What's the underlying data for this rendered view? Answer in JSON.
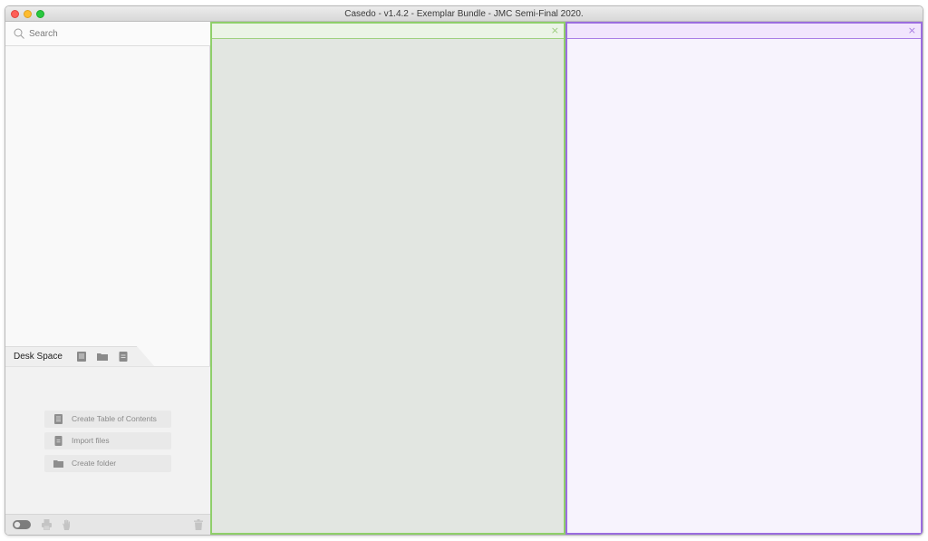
{
  "window": {
    "title": "Casedo - v1.4.2 - Exemplar Bundle - JMC Semi-Final 2020."
  },
  "sidebar": {
    "search": {
      "placeholder": "Search",
      "value": ""
    },
    "desk_space": {
      "tab_label": "Desk Space",
      "tab_icons": [
        "table-of-contents-icon",
        "folder-icon",
        "document-icon"
      ],
      "actions": [
        {
          "label": "Create Table of Contents",
          "icon": "table-of-contents-icon"
        },
        {
          "label": "Import files",
          "icon": "document-icon"
        },
        {
          "label": "Create folder",
          "icon": "folder-icon"
        }
      ]
    },
    "bottom_bar": {
      "icons": [
        "toggle-icon",
        "print-icon",
        "hand-icon",
        "trash-icon"
      ]
    }
  },
  "panes": {
    "left": {
      "accent": "#8fcf6a",
      "close_label": "×"
    },
    "right": {
      "accent": "#9b6ddf",
      "close_label": "×"
    }
  }
}
